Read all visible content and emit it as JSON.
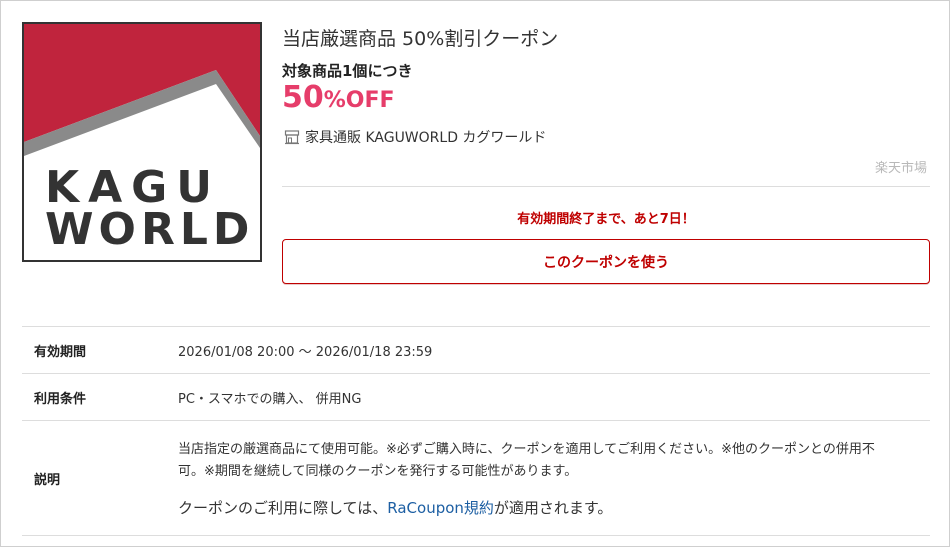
{
  "logo": {
    "alt": "KAGU WORLD",
    "line1": "KAGU",
    "line2": "WORLD",
    "colors": {
      "red": "#c0243d",
      "gray": "#8a8a8a",
      "dark": "#333333"
    }
  },
  "coupon": {
    "title": "当店厳選商品 50%割引クーポン",
    "unit_note": "対象商品1個につき",
    "discount_value": "50",
    "discount_suffix": "%OFF",
    "shop_icon": "shop-icon",
    "shop_name": "家具通販 KAGUWORLD カグワールド",
    "source": "楽天市場",
    "expiry_notice": "有効期間終了まで、あと7日！",
    "use_button": "このクーポンを使う"
  },
  "details": {
    "validity_label": "有効期間",
    "validity_value": "2026/01/08 20:00 〜 2026/01/18 23:59",
    "conditions_label": "利用条件",
    "conditions_value": "PC・スマホでの購入、 併用NG",
    "description_label": "説明",
    "description_text": "当店指定の厳選商品にて使用可能。※必ずご購入時に、クーポンを適用してご利用ください。※他のクーポンとの併用不可。※期間を継続して同様のクーポンを発行する可能性があります。",
    "terms_prefix": "クーポンのご利用に際しては、",
    "terms_link": "RaCoupon規約",
    "terms_suffix": "が適用されます。"
  },
  "colors": {
    "accent_red": "#bf0000",
    "discount_pink": "#e63d6a",
    "link_blue": "#1d5fa3"
  }
}
